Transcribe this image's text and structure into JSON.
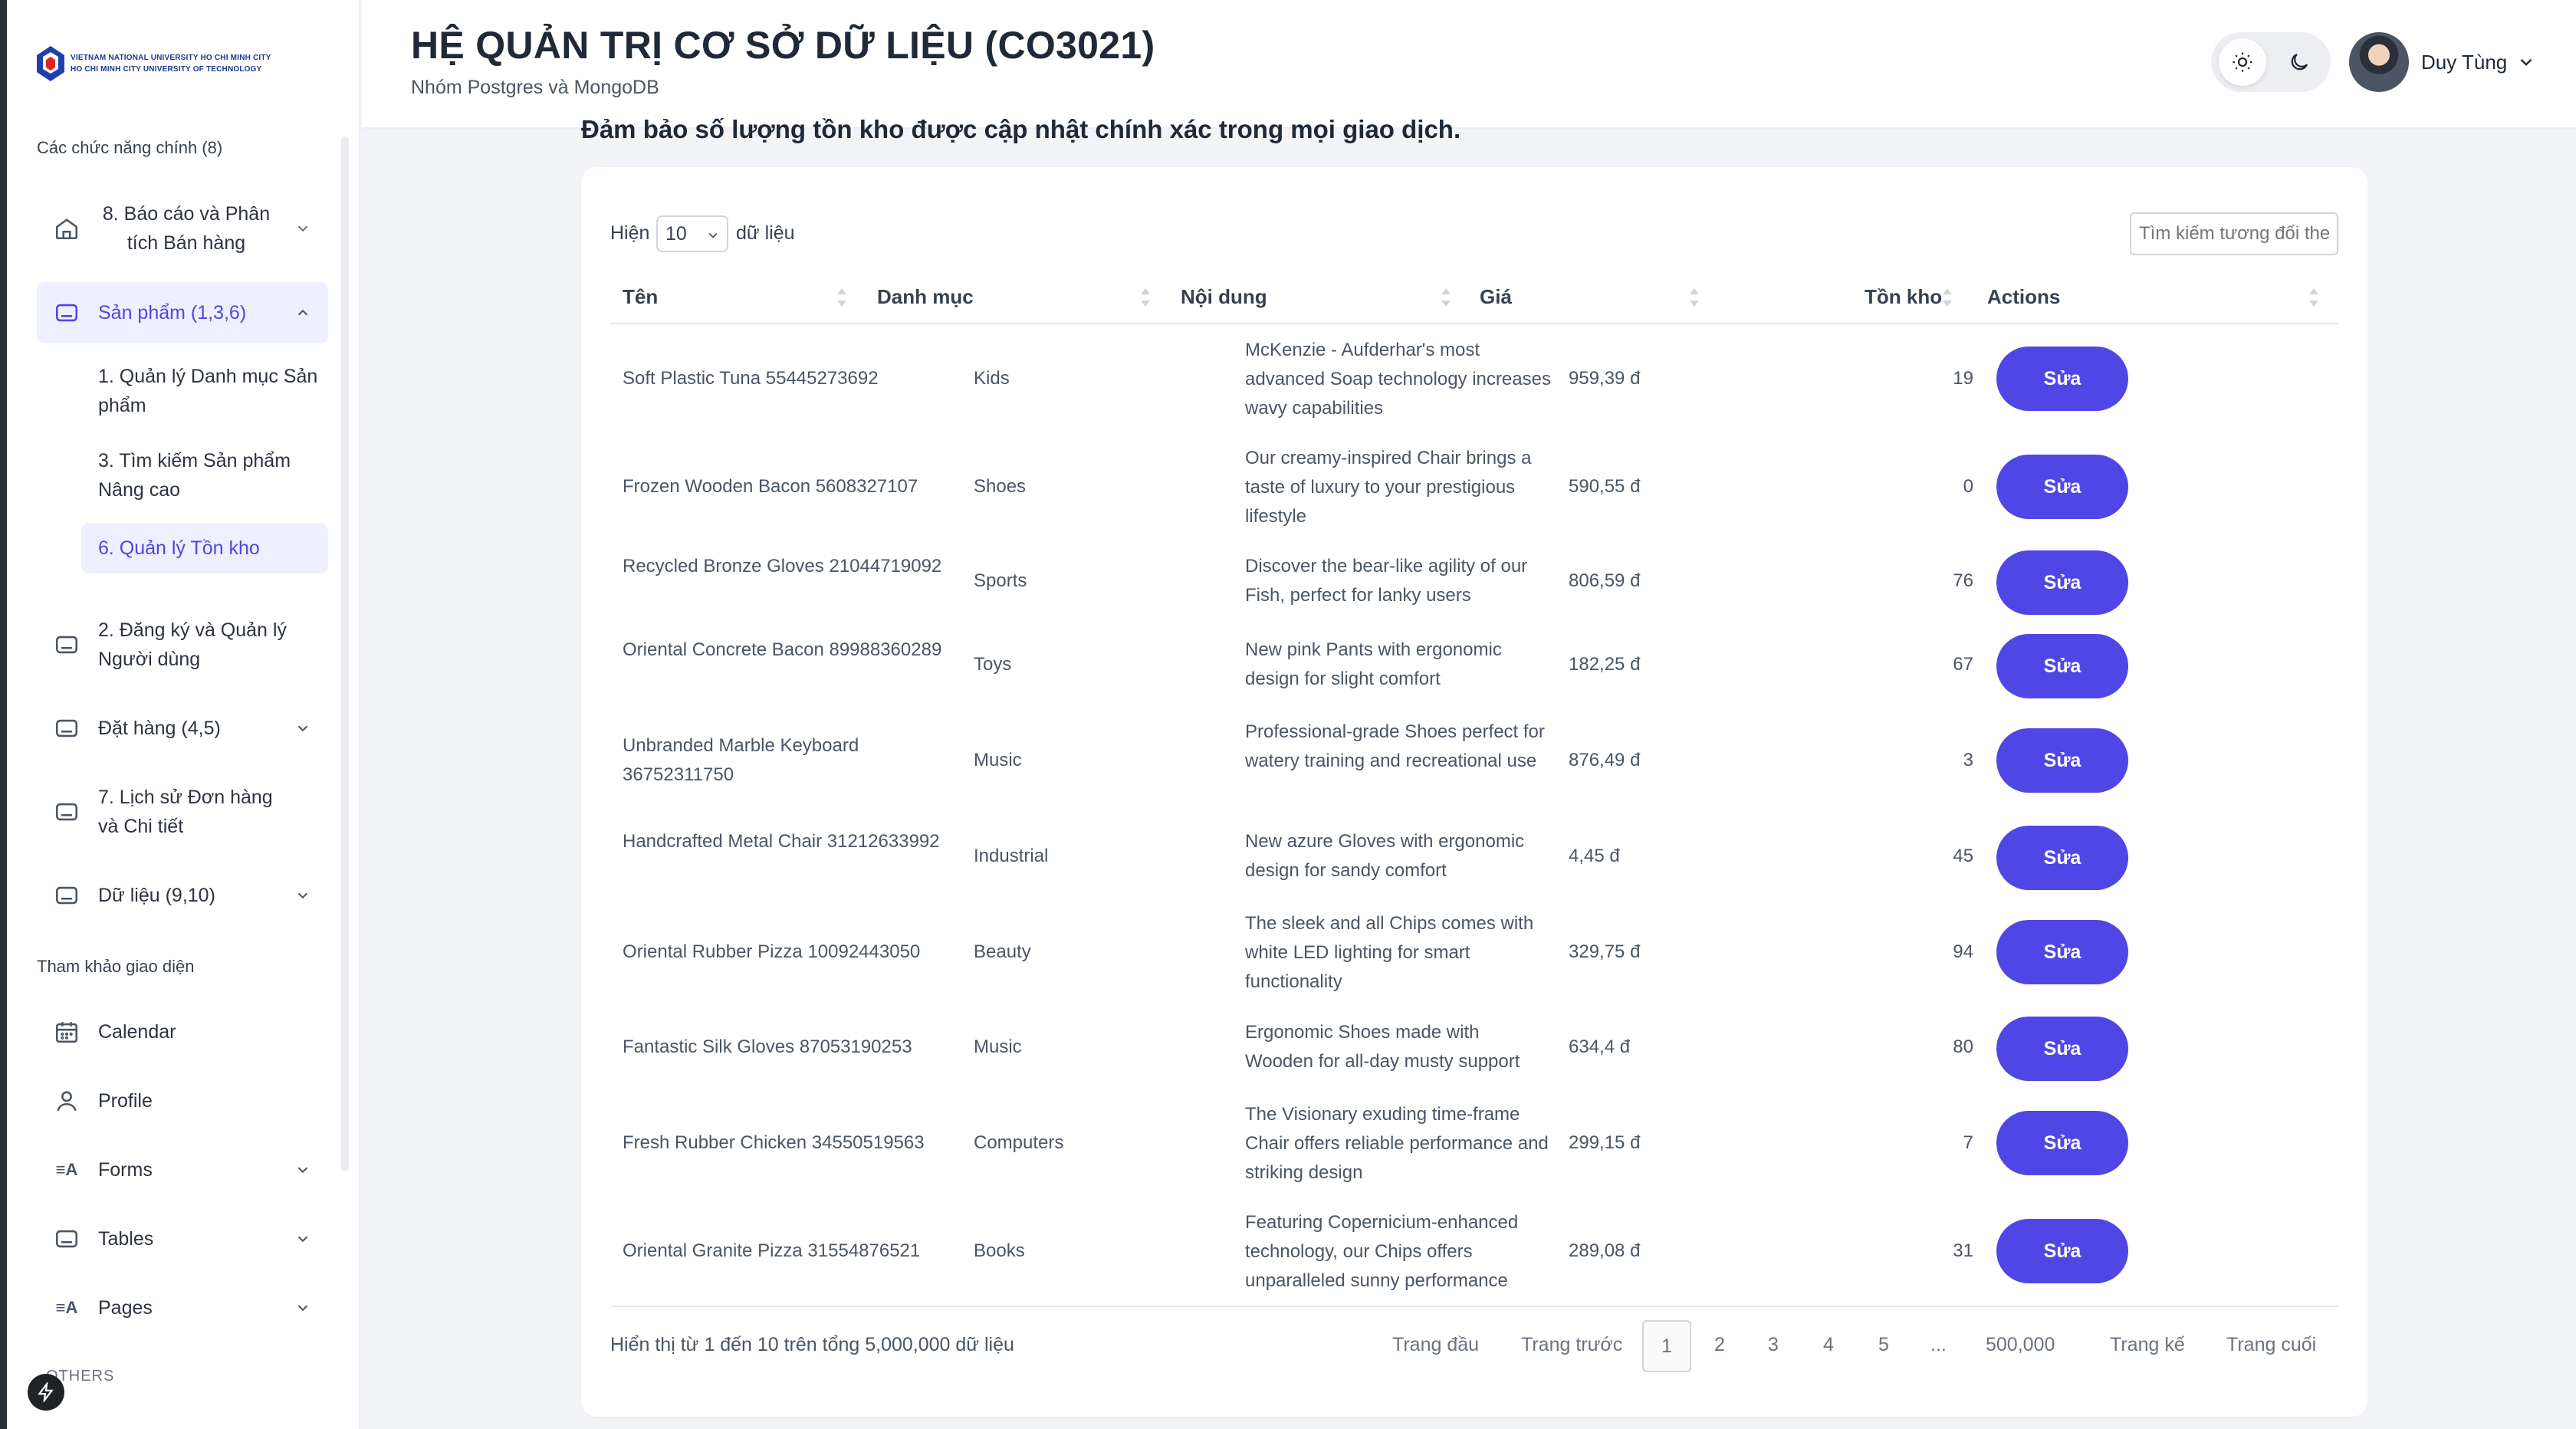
{
  "logo": {
    "line1": "VIETNAM NATIONAL UNIVERSITY HO CHI MINH CITY",
    "line2": "HO CHI MINH CITY UNIVERSITY OF TECHNOLOGY"
  },
  "sidebar": {
    "main_section": "Các chức năng chính (8)",
    "items": [
      {
        "label": "8. Báo cáo và Phân tích Bán hàng",
        "icon": "home-icon"
      },
      {
        "label": "Sản phẩm (1,3,6)",
        "icon": "box-icon"
      },
      {
        "label": "2. Đăng ký và Quản lý Người dùng",
        "icon": "box-icon"
      },
      {
        "label": "Đặt hàng (4,5)",
        "icon": "box-icon"
      },
      {
        "label": "7. Lịch sử Đơn hàng và Chi tiết",
        "icon": "box-icon"
      },
      {
        "label": "Dữ liệu (9,10)",
        "icon": "box-icon"
      }
    ],
    "sub_items": [
      {
        "label": "1. Quản lý Danh mục Sản phẩm"
      },
      {
        "label": "3. Tìm kiếm Sản phẩm Nâng cao"
      },
      {
        "label": "6. Quản lý Tồn kho"
      }
    ],
    "ref_section": "Tham khảo giao diện",
    "ref_items": [
      {
        "label": "Calendar",
        "icon": "calendar-icon"
      },
      {
        "label": "Profile",
        "icon": "user-icon"
      },
      {
        "label": "Forms",
        "icon": "forms-icon"
      },
      {
        "label": "Tables",
        "icon": "box-icon"
      },
      {
        "label": "Pages",
        "icon": "forms-icon"
      }
    ],
    "others_label": "OTHERS"
  },
  "header": {
    "title": "HỆ QUẢN TRỊ CƠ SỞ DỮ LIỆU (CO3021)",
    "subtitle": "Nhóm Postgres và MongoDB",
    "user_name": "Duy Tùng"
  },
  "main": {
    "intro": "Đảm bảo số lượng tồn kho được cập nhật chính xác trong mọi giao dịch.",
    "show_label": "Hiện",
    "page_size": "10",
    "show_suffix": "dữ liệu",
    "search_placeholder": "Tìm kiếm tương đối theo tên",
    "columns": [
      "Tên",
      "Danh mục",
      "Nội dung",
      "Giá",
      "Tồn kho",
      "Actions"
    ],
    "edit_label": "Sửa",
    "rows": [
      {
        "name": "Soft Plastic Tuna 55445273692",
        "category": "Kids",
        "desc": "McKenzie - Aufderhar's most advanced Soap technology increases wavy capabilities",
        "price": "959,39 đ",
        "stock": "19"
      },
      {
        "name": "Frozen Wooden Bacon 5608327107",
        "category": "Shoes",
        "desc": "Our creamy-inspired Chair brings a taste of luxury to your prestigious lifestyle",
        "price": "590,55 đ",
        "stock": "0"
      },
      {
        "name": "Recycled Bronze Gloves 21044719092",
        "category": "Sports",
        "desc": "Discover the bear-like agility of our Fish, perfect for lanky users",
        "price": "806,59 đ",
        "stock": "76"
      },
      {
        "name": "Oriental Concrete Bacon 89988360289",
        "category": "Toys",
        "desc": "New pink Pants with ergonomic design for slight comfort",
        "price": "182,25 đ",
        "stock": "67"
      },
      {
        "name": "Unbranded Marble Keyboard 36752311750",
        "category": "Music",
        "desc": "Professional-grade Shoes perfect for watery training and recreational use",
        "price": "876,49 đ",
        "stock": "3"
      },
      {
        "name": "Handcrafted Metal Chair 31212633992",
        "category": "Industrial",
        "desc": "New azure Gloves with ergonomic design for sandy comfort",
        "price": "4,45 đ",
        "stock": "45"
      },
      {
        "name": "Oriental Rubber Pizza 10092443050",
        "category": "Beauty",
        "desc": "The sleek and all Chips comes with white LED lighting for smart functionality",
        "price": "329,75 đ",
        "stock": "94"
      },
      {
        "name": "Fantastic Silk Gloves 87053190253",
        "category": "Music",
        "desc": "Ergonomic Shoes made with Wooden for all-day musty support",
        "price": "634,4 đ",
        "stock": "80"
      },
      {
        "name": "Fresh Rubber Chicken 34550519563",
        "category": "Computers",
        "desc": "The Visionary exuding time-frame Chair offers reliable performance and striking design",
        "price": "299,15 đ",
        "stock": "7"
      },
      {
        "name": "Oriental Granite Pizza 31554876521",
        "category": "Books",
        "desc": "Featuring Copernicium-enhanced technology, our Chips offers unparalleled sunny performance",
        "price": "289,08 đ",
        "stock": "31"
      }
    ],
    "footer_info": "Hiển thị từ 1 đến 10 trên tổng 5,000,000 dữ liệu",
    "pagination": {
      "first": "Trang đầu",
      "prev": "Trang trước",
      "pages": [
        "1",
        "2",
        "3",
        "4",
        "5",
        "...",
        "500,000"
      ],
      "next": "Trang kế",
      "last": "Trang cuối"
    }
  },
  "colors": {
    "accent": "#5046e5",
    "active_bg": "#eef0ff",
    "page_bg": "#f3f4f8"
  }
}
